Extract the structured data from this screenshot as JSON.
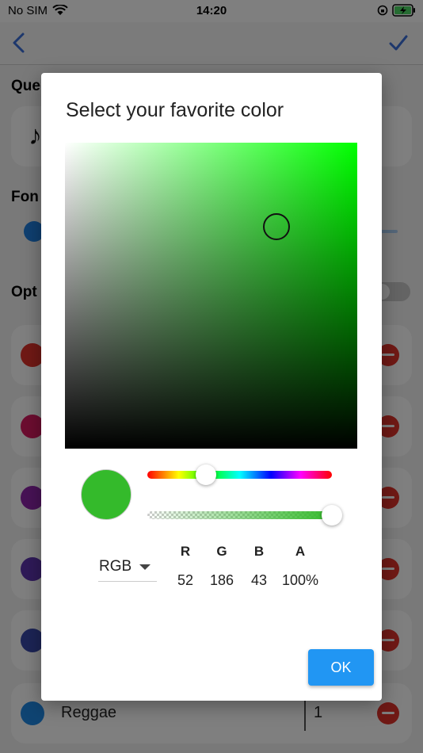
{
  "status_bar": {
    "carrier": "No SIM",
    "time": "14:20"
  },
  "background": {
    "section_queue": "Que",
    "section_font": "Fon",
    "section_options": "Opt",
    "reggae_row": {
      "name": "Reggae",
      "count": "1"
    },
    "genre_dot_colors": [
      "#e0322a",
      "#d81b60",
      "#8e24aa",
      "#5e35b1",
      "#3949ab",
      "#1e88e5"
    ]
  },
  "dialog": {
    "title": "Select your favorite color",
    "hue": "#00ff00",
    "selected_color": "#34ba2b",
    "color_mode": "RGB",
    "channels": [
      {
        "label": "R",
        "value": "52"
      },
      {
        "label": "G",
        "value": "186"
      },
      {
        "label": "B",
        "value": "43"
      },
      {
        "label": "A",
        "value": "100%"
      }
    ],
    "ok_label": "OK"
  }
}
